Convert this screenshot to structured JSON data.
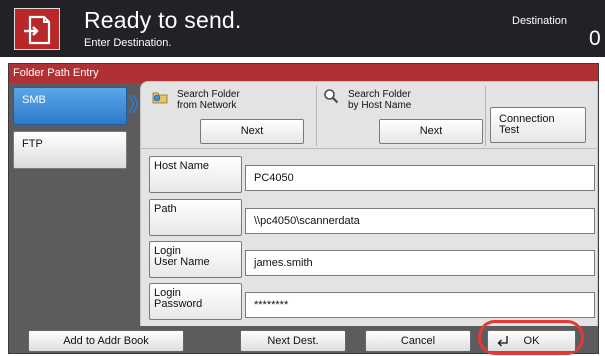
{
  "header": {
    "icon": "send-document-icon",
    "title": "Ready to send.",
    "subtitle": "Enter Destination.",
    "destination_label": "Destination",
    "destination_count": "0",
    "colors": {
      "background": "#222226",
      "icon_bg": "#b8282b"
    }
  },
  "dialog": {
    "title": "Folder Path Entry",
    "colors": {
      "title_bar": "#b13033",
      "frame": "#5c5c5e",
      "selected_tab": "#2e79c8"
    }
  },
  "tabs": [
    {
      "label": "SMB",
      "selected": true
    },
    {
      "label": "FTP",
      "selected": false
    }
  ],
  "toolbar": {
    "search_network": {
      "icon": "network-folder-icon",
      "label_line1": "Search Folder",
      "label_line2": "from Network",
      "button": "Next"
    },
    "search_host": {
      "icon": "magnifier-icon",
      "label_line1": "Search Folder",
      "label_line2": "by Host Name",
      "button": "Next"
    },
    "connection_test": {
      "line1": "Connection",
      "line2": "Test"
    }
  },
  "fields": {
    "host_name": {
      "label": "Host Name",
      "value": "PC4050"
    },
    "path": {
      "label": "Path",
      "value": "\\\\pc4050\\scannerdata"
    },
    "login_user": {
      "label_line1": "Login",
      "label_line2": "User Name",
      "value": "james.smith"
    },
    "login_password": {
      "label_line1": "Login",
      "label_line2": "Password",
      "value": "********"
    }
  },
  "bottom": {
    "add_to_addr_book": "Add to Addr Book",
    "next_dest": "Next Dest.",
    "cancel": "Cancel",
    "ok": "OK",
    "ok_icon": "enter-return-icon",
    "highlight_color": "#e53935"
  }
}
